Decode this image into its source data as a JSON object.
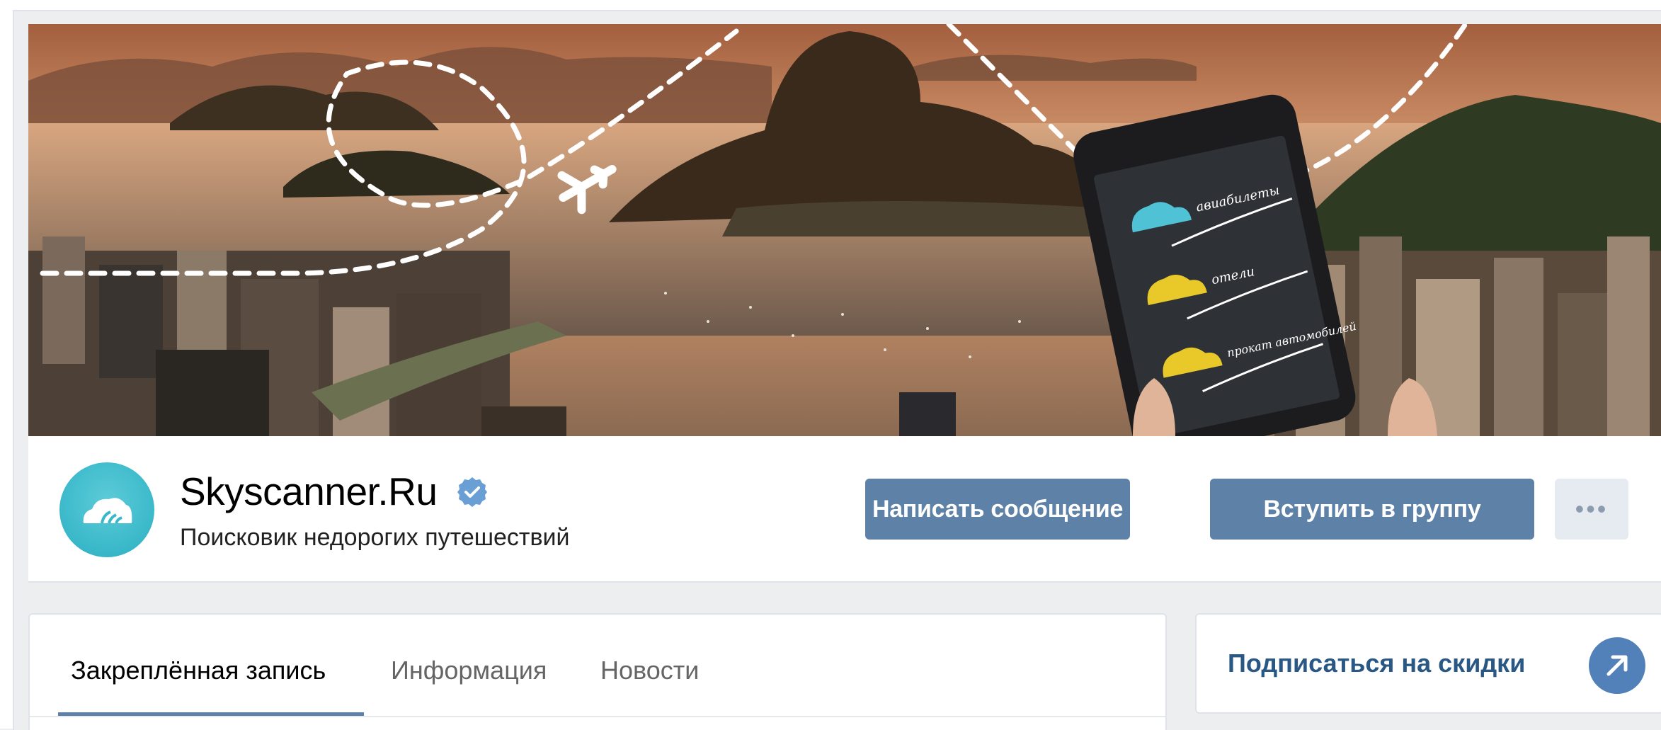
{
  "group": {
    "name": "Skyscanner.Ru",
    "status": "Поисковик недорогих путешествий"
  },
  "actions": {
    "message_label": "Написать сообщение",
    "join_label": "Вступить в группу",
    "more_label": "•••"
  },
  "tabs": [
    {
      "label": "Закреплённая запись",
      "active": true
    },
    {
      "label": "Информация",
      "active": false
    },
    {
      "label": "Новости",
      "active": false
    }
  ],
  "sidebar": {
    "subscribe_label": "Подписаться на скидки"
  },
  "cover": {
    "phone_labels": [
      "авиабилеты",
      "отели",
      "прокат автомобилей"
    ]
  },
  "icons": {
    "verified": "verified-check-icon",
    "subscribe": "arrow-up-right-icon",
    "plane": "plane-icon"
  },
  "colors": {
    "button": "#5e81a8",
    "link": "#2a5885",
    "avatar": "#39b8c9",
    "tab_underline": "#5e81a8"
  }
}
